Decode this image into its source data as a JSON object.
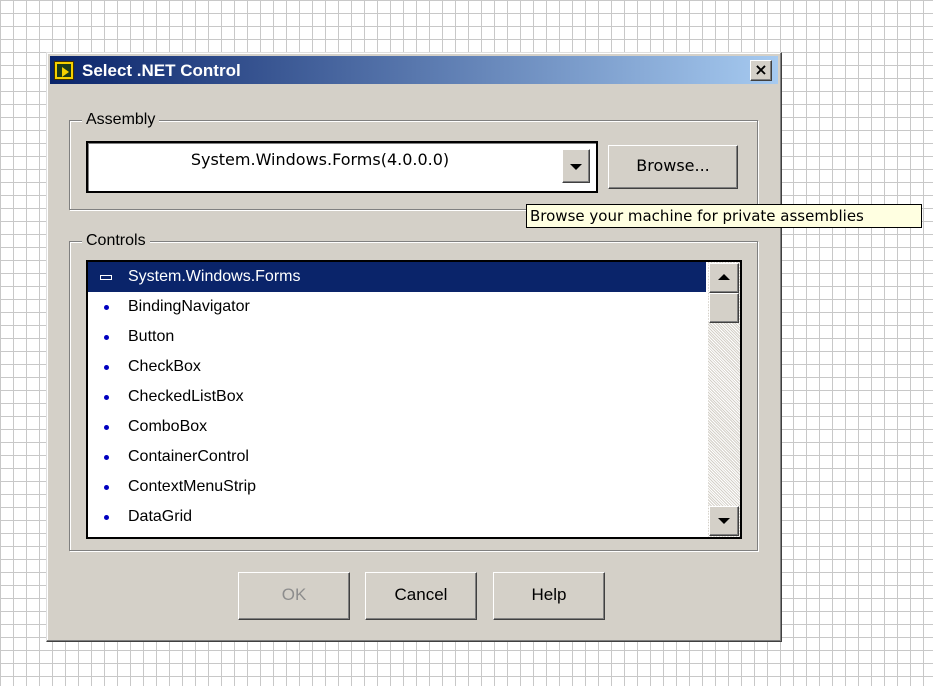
{
  "dialog": {
    "title": "Select .NET Control",
    "close_label": "×"
  },
  "assembly": {
    "group_label": "Assembly",
    "selected": "System.Windows.Forms(4.0.0.0)",
    "browse_label": "Browse...",
    "tooltip": "Browse your machine for private assemblies"
  },
  "controls": {
    "group_label": "Controls",
    "items": [
      {
        "label": "System.Windows.Forms",
        "selected": true
      },
      {
        "label": "BindingNavigator"
      },
      {
        "label": "Button"
      },
      {
        "label": "CheckBox"
      },
      {
        "label": "CheckedListBox"
      },
      {
        "label": "ComboBox"
      },
      {
        "label": "ContainerControl"
      },
      {
        "label": "ContextMenuStrip"
      },
      {
        "label": "DataGrid"
      }
    ]
  },
  "buttons": {
    "ok": "OK",
    "cancel": "Cancel",
    "help": "Help"
  },
  "colors": {
    "title_bar": "#0a246a",
    "selection": "#0a246a",
    "tooltip_bg": "#ffffe1",
    "dialog_bg": "#d4d0c8"
  }
}
